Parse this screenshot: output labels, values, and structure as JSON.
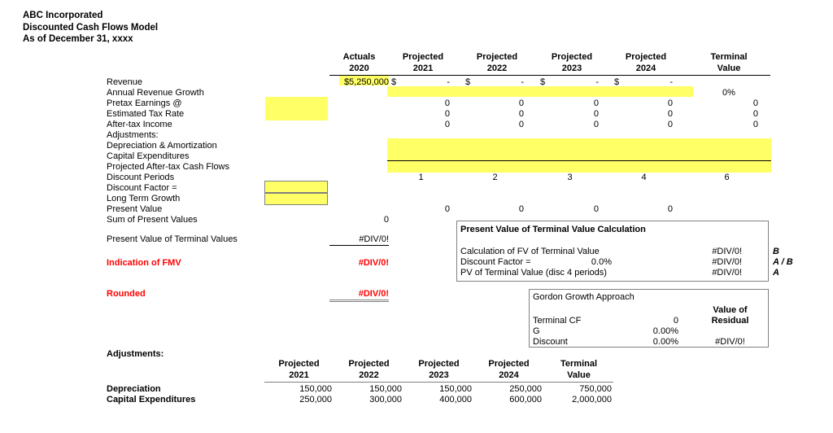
{
  "document": {
    "title_lines": [
      "ABC Incorporated",
      "Discounted Cash Flows Model",
      "As of December 31, xxxx"
    ]
  },
  "main_table": {
    "column_headers": [
      {
        "top": "Actuals",
        "bottom": "2020"
      },
      {
        "top": "Projected",
        "bottom": "2021"
      },
      {
        "top": "Projected",
        "bottom": "2022"
      },
      {
        "top": "Projected",
        "bottom": "2023"
      },
      {
        "top": "Projected",
        "bottom": "2024"
      },
      {
        "top": "Terminal",
        "bottom": "Value"
      }
    ],
    "row_labels": [
      "Revenue",
      "Annual Revenue Growth",
      "Pretax Earnings @",
      "Estimated Tax Rate",
      "After-tax Income",
      "Adjustments:",
      "Depreciation & Amortization",
      "Capital Expenditures",
      "Projected After-tax Cash Flows",
      "Discount Periods",
      "Discount Factor      =",
      "Long Term Growth",
      "Present Value",
      "Sum of Present Values"
    ],
    "revenue": {
      "actual_2020": "$5,250,000",
      "currency_symbol": "$",
      "dash": "-",
      "projected": [
        "-",
        "-",
        "-",
        "-"
      ]
    },
    "annual_revenue_growth": {
      "terminal": "0%"
    },
    "pretax_earnings": {
      "values": [
        "0",
        "0",
        "0",
        "0",
        "0"
      ]
    },
    "estimated_tax_rate": {
      "values": [
        "0",
        "0",
        "0",
        "0",
        "0"
      ]
    },
    "after_tax_income": {
      "values": [
        "0",
        "0",
        "0",
        "0",
        "0"
      ]
    },
    "discount_periods": {
      "values": [
        "1",
        "2",
        "3",
        "4",
        "6"
      ]
    },
    "present_value": {
      "values": [
        "0",
        "0",
        "0",
        "0"
      ]
    },
    "sum_of_present_values": {
      "value": "0"
    }
  },
  "summary": {
    "pv_terminal_values_label": "Present Value of Terminal Values",
    "pv_terminal_values_value": "#DIV/0!",
    "indication_of_fmv_label": "Indication of FMV",
    "indication_of_fmv_value": "#DIV/0!",
    "rounded_label": "Rounded",
    "rounded_value": "#DIV/0!",
    "error_color": "#FF0000"
  },
  "pv_terminal_panel": {
    "title": "Present Value of Terminal Value Calculation",
    "rows": [
      {
        "label": "Calculation of FV of Terminal Value",
        "mid": "",
        "value": "#DIV/0!",
        "tag": "B"
      },
      {
        "label": "Discount Factor  =",
        "mid": "0.0%",
        "value": "#DIV/0!",
        "tag": "A / B"
      },
      {
        "label": "PV of Terminal Value (disc 4 periods)",
        "mid": "",
        "value": "#DIV/0!",
        "tag": "A"
      }
    ]
  },
  "gordon_panel": {
    "title": "Gordon Growth Approach",
    "col_header_line1": "Value of",
    "col_header_line2": "Residual",
    "rows": [
      {
        "label": "Terminal CF",
        "value": "0",
        "residual": ""
      },
      {
        "label": "G",
        "value": "0.00%",
        "residual": ""
      },
      {
        "label": "Discount",
        "value": "0.00%",
        "residual": "#DIV/0!"
      }
    ]
  },
  "adjustments_table": {
    "section_label": "Adjustments:",
    "column_headers": [
      {
        "top": "Projected",
        "bottom": "2021"
      },
      {
        "top": "Projected",
        "bottom": "2022"
      },
      {
        "top": "Projected",
        "bottom": "2023"
      },
      {
        "top": "Projected",
        "bottom": "2024"
      },
      {
        "top": "Terminal",
        "bottom": "Value"
      }
    ],
    "rows": [
      {
        "label": "Depreciation",
        "values": [
          "150,000",
          "150,000",
          "150,000",
          "250,000",
          "750,000"
        ]
      },
      {
        "label": "Capital Expenditures",
        "values": [
          "250,000",
          "300,000",
          "400,000",
          "600,000",
          "2,000,000"
        ]
      }
    ]
  },
  "colors": {
    "highlight": "#FFFF66",
    "rule": "#000000",
    "panel_border": "#808080"
  }
}
